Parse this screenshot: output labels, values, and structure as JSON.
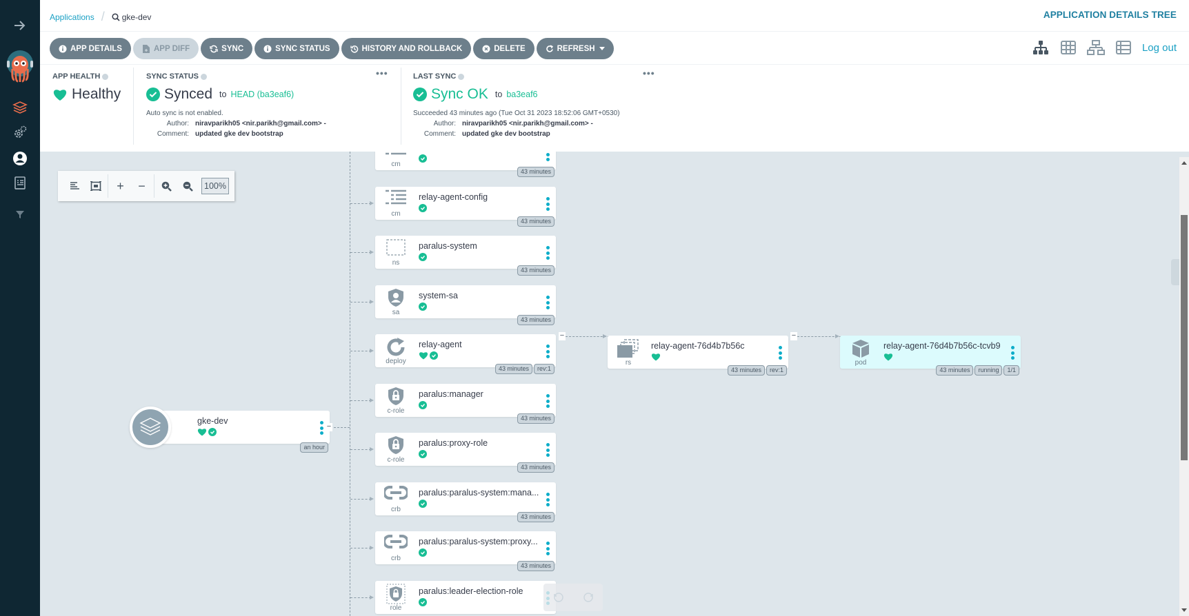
{
  "sidebar": {
    "items": [
      {
        "icon": "expand-arrow-icon"
      },
      {
        "icon": "argo-logo-icon"
      },
      {
        "icon": "applications-icon"
      },
      {
        "icon": "settings-icon"
      },
      {
        "icon": "user-info-icon"
      },
      {
        "icon": "docs-icon"
      },
      {
        "icon": "filter-icon"
      }
    ]
  },
  "header": {
    "breadcrumb_root": "Applications",
    "breadcrumb_current": "gke-dev",
    "page_title": "APPLICATION DETAILS TREE",
    "logout": "Log out"
  },
  "toolbar": {
    "buttons": [
      {
        "label": "APP DETAILS",
        "icon": "info-icon",
        "disabled": false
      },
      {
        "label": "APP DIFF",
        "icon": "file-diff-icon",
        "disabled": true
      },
      {
        "label": "SYNC",
        "icon": "sync-icon",
        "disabled": false
      },
      {
        "label": "SYNC STATUS",
        "icon": "info-icon",
        "disabled": false
      },
      {
        "label": "HISTORY AND ROLLBACK",
        "icon": "history-icon",
        "disabled": false
      },
      {
        "label": "DELETE",
        "icon": "delete-icon",
        "disabled": false
      },
      {
        "label": "REFRESH",
        "icon": "refresh-icon",
        "disabled": false
      }
    ],
    "view_modes": [
      "tree-view-icon",
      "pods-view-icon",
      "network-view-icon",
      "list-view-icon"
    ]
  },
  "status": {
    "app_health": {
      "title": "APP HEALTH",
      "value": "Healthy"
    },
    "sync_status": {
      "title": "SYNC STATUS",
      "value": "Synced",
      "to": "to",
      "revision": "HEAD (ba3eaf6)",
      "note": "Auto sync is not enabled.",
      "author_label": "Author:",
      "author": "niravparikh05 <nir.parikh@gmail.com> -",
      "comment_label": "Comment:",
      "comment": "updated gke dev bootstrap"
    },
    "last_sync": {
      "title": "LAST SYNC",
      "value": "Sync OK",
      "to": "to",
      "revision": "ba3eaf6",
      "note": "Succeeded 43 minutes ago (Tue Oct 31 2023 18:52:06 GMT+0530)",
      "author_label": "Author:",
      "author": "niravparikh05 <nir.parikh@gmail.com> -",
      "comment_label": "Comment:",
      "comment": "updated gke dev bootstrap"
    },
    "more": "•••"
  },
  "graph_toolbar": {
    "zoom_level": "100%"
  },
  "app_node": {
    "name": "gke-dev",
    "age": "an hour",
    "health": "Healthy",
    "sync": "Synced"
  },
  "resources": [
    {
      "name": "",
      "kind": "cm",
      "age": "43 minutes",
      "icon": "configmap-icon"
    },
    {
      "name": "relay-agent-config",
      "kind": "cm",
      "age": "43 minutes",
      "icon": "configmap-icon"
    },
    {
      "name": "paralus-system",
      "kind": "ns",
      "age": "43 minutes",
      "icon": "namespace-icon"
    },
    {
      "name": "system-sa",
      "kind": "sa",
      "age": "43 minutes",
      "icon": "serviceaccount-icon"
    },
    {
      "name": "relay-agent",
      "kind": "deploy",
      "age": "43 minutes",
      "rev": "rev:1",
      "icon": "deployment-icon"
    },
    {
      "name": "paralus:manager",
      "kind": "c-role",
      "age": "43 minutes",
      "icon": "clusterrole-icon"
    },
    {
      "name": "paralus:proxy-role",
      "kind": "c-role",
      "age": "43 minutes",
      "icon": "clusterrole-icon"
    },
    {
      "name": "paralus:paralus-system:mana...",
      "kind": "crb",
      "age": "43 minutes",
      "icon": "clusterrolebinding-icon"
    },
    {
      "name": "paralus:paralus-system:proxy...",
      "kind": "crb",
      "age": "43 minutes",
      "icon": "clusterrolebinding-icon"
    },
    {
      "name": "paralus:leader-election-role",
      "kind": "role",
      "age": "",
      "icon": "role-icon"
    }
  ],
  "replicaset": {
    "name": "relay-agent-76d4b7b56c",
    "kind": "rs",
    "age": "43 minutes",
    "rev": "rev:1"
  },
  "pod": {
    "name": "relay-agent-76d4b7b56c-tcvb9",
    "kind": "pod",
    "age": "43 minutes",
    "status": "running",
    "ready": "1/1"
  },
  "colors": {
    "accent": "#1aa0c4",
    "healthy": "#18be94",
    "sidebar": "#0f2733",
    "button": "#6d7f8b",
    "canvas": "#dee6eb"
  }
}
